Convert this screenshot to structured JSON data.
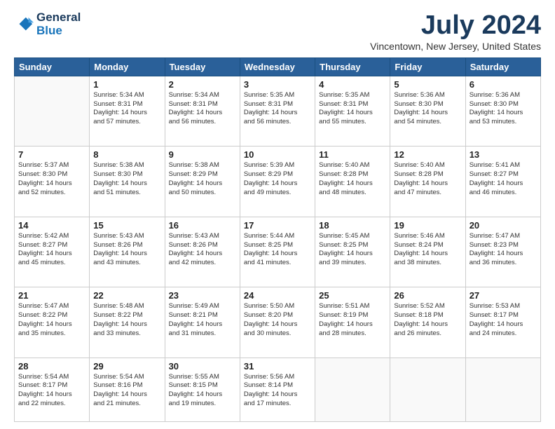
{
  "logo": {
    "line1": "General",
    "line2": "Blue"
  },
  "title": "July 2024",
  "location": "Vincentown, New Jersey, United States",
  "days_header": [
    "Sunday",
    "Monday",
    "Tuesday",
    "Wednesday",
    "Thursday",
    "Friday",
    "Saturday"
  ],
  "weeks": [
    [
      {
        "day": "",
        "info": ""
      },
      {
        "day": "1",
        "info": "Sunrise: 5:34 AM\nSunset: 8:31 PM\nDaylight: 14 hours\nand 57 minutes."
      },
      {
        "day": "2",
        "info": "Sunrise: 5:34 AM\nSunset: 8:31 PM\nDaylight: 14 hours\nand 56 minutes."
      },
      {
        "day": "3",
        "info": "Sunrise: 5:35 AM\nSunset: 8:31 PM\nDaylight: 14 hours\nand 56 minutes."
      },
      {
        "day": "4",
        "info": "Sunrise: 5:35 AM\nSunset: 8:31 PM\nDaylight: 14 hours\nand 55 minutes."
      },
      {
        "day": "5",
        "info": "Sunrise: 5:36 AM\nSunset: 8:30 PM\nDaylight: 14 hours\nand 54 minutes."
      },
      {
        "day": "6",
        "info": "Sunrise: 5:36 AM\nSunset: 8:30 PM\nDaylight: 14 hours\nand 53 minutes."
      }
    ],
    [
      {
        "day": "7",
        "info": "Sunrise: 5:37 AM\nSunset: 8:30 PM\nDaylight: 14 hours\nand 52 minutes."
      },
      {
        "day": "8",
        "info": "Sunrise: 5:38 AM\nSunset: 8:30 PM\nDaylight: 14 hours\nand 51 minutes."
      },
      {
        "day": "9",
        "info": "Sunrise: 5:38 AM\nSunset: 8:29 PM\nDaylight: 14 hours\nand 50 minutes."
      },
      {
        "day": "10",
        "info": "Sunrise: 5:39 AM\nSunset: 8:29 PM\nDaylight: 14 hours\nand 49 minutes."
      },
      {
        "day": "11",
        "info": "Sunrise: 5:40 AM\nSunset: 8:28 PM\nDaylight: 14 hours\nand 48 minutes."
      },
      {
        "day": "12",
        "info": "Sunrise: 5:40 AM\nSunset: 8:28 PM\nDaylight: 14 hours\nand 47 minutes."
      },
      {
        "day": "13",
        "info": "Sunrise: 5:41 AM\nSunset: 8:27 PM\nDaylight: 14 hours\nand 46 minutes."
      }
    ],
    [
      {
        "day": "14",
        "info": "Sunrise: 5:42 AM\nSunset: 8:27 PM\nDaylight: 14 hours\nand 45 minutes."
      },
      {
        "day": "15",
        "info": "Sunrise: 5:43 AM\nSunset: 8:26 PM\nDaylight: 14 hours\nand 43 minutes."
      },
      {
        "day": "16",
        "info": "Sunrise: 5:43 AM\nSunset: 8:26 PM\nDaylight: 14 hours\nand 42 minutes."
      },
      {
        "day": "17",
        "info": "Sunrise: 5:44 AM\nSunset: 8:25 PM\nDaylight: 14 hours\nand 41 minutes."
      },
      {
        "day": "18",
        "info": "Sunrise: 5:45 AM\nSunset: 8:25 PM\nDaylight: 14 hours\nand 39 minutes."
      },
      {
        "day": "19",
        "info": "Sunrise: 5:46 AM\nSunset: 8:24 PM\nDaylight: 14 hours\nand 38 minutes."
      },
      {
        "day": "20",
        "info": "Sunrise: 5:47 AM\nSunset: 8:23 PM\nDaylight: 14 hours\nand 36 minutes."
      }
    ],
    [
      {
        "day": "21",
        "info": "Sunrise: 5:47 AM\nSunset: 8:22 PM\nDaylight: 14 hours\nand 35 minutes."
      },
      {
        "day": "22",
        "info": "Sunrise: 5:48 AM\nSunset: 8:22 PM\nDaylight: 14 hours\nand 33 minutes."
      },
      {
        "day": "23",
        "info": "Sunrise: 5:49 AM\nSunset: 8:21 PM\nDaylight: 14 hours\nand 31 minutes."
      },
      {
        "day": "24",
        "info": "Sunrise: 5:50 AM\nSunset: 8:20 PM\nDaylight: 14 hours\nand 30 minutes."
      },
      {
        "day": "25",
        "info": "Sunrise: 5:51 AM\nSunset: 8:19 PM\nDaylight: 14 hours\nand 28 minutes."
      },
      {
        "day": "26",
        "info": "Sunrise: 5:52 AM\nSunset: 8:18 PM\nDaylight: 14 hours\nand 26 minutes."
      },
      {
        "day": "27",
        "info": "Sunrise: 5:53 AM\nSunset: 8:17 PM\nDaylight: 14 hours\nand 24 minutes."
      }
    ],
    [
      {
        "day": "28",
        "info": "Sunrise: 5:54 AM\nSunset: 8:17 PM\nDaylight: 14 hours\nand 22 minutes."
      },
      {
        "day": "29",
        "info": "Sunrise: 5:54 AM\nSunset: 8:16 PM\nDaylight: 14 hours\nand 21 minutes."
      },
      {
        "day": "30",
        "info": "Sunrise: 5:55 AM\nSunset: 8:15 PM\nDaylight: 14 hours\nand 19 minutes."
      },
      {
        "day": "31",
        "info": "Sunrise: 5:56 AM\nSunset: 8:14 PM\nDaylight: 14 hours\nand 17 minutes."
      },
      {
        "day": "",
        "info": ""
      },
      {
        "day": "",
        "info": ""
      },
      {
        "day": "",
        "info": ""
      }
    ]
  ]
}
